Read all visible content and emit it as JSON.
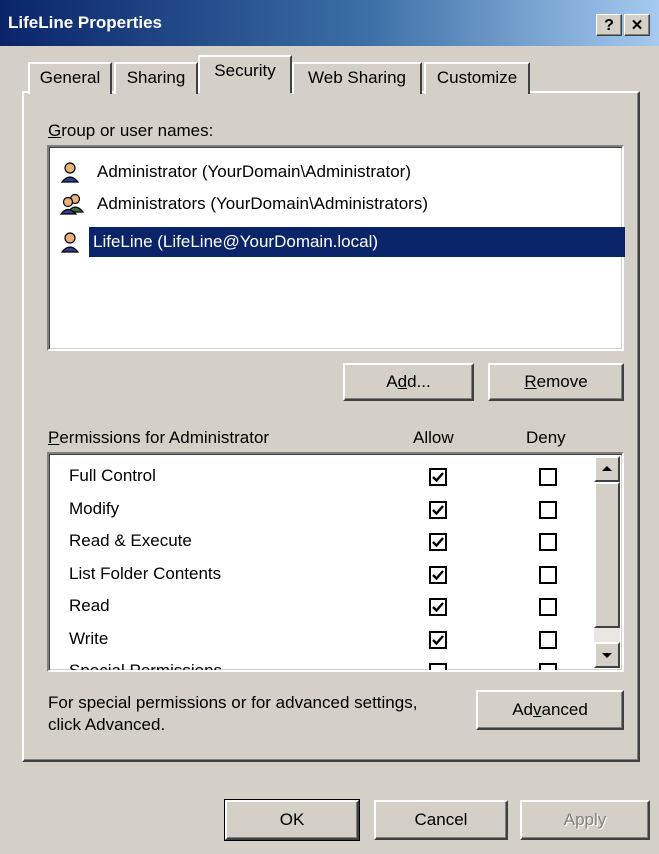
{
  "window": {
    "title": "LifeLine Properties",
    "help_button": "?",
    "close_button": "✕"
  },
  "tabs": [
    {
      "label": "General"
    },
    {
      "label": "Sharing"
    },
    {
      "label": "Security",
      "active": true
    },
    {
      "label": "Web Sharing"
    },
    {
      "label": "Customize"
    }
  ],
  "group_list": {
    "label_prefix": "G",
    "label_rest": "roup or user names:",
    "items": [
      {
        "name": "Administrator (YourDomain\\Administrator)",
        "icon": "user-icon",
        "selected": false
      },
      {
        "name": "Administrators (YourDomain\\Administrators)",
        "icon": "group-icon",
        "selected": false
      },
      {
        "name": "LifeLine (LifeLine@YourDomain.local)",
        "icon": "user-icon",
        "selected": true
      }
    ]
  },
  "buttons": {
    "add_pre": "A",
    "add_u": "d",
    "add_post": "d...",
    "remove_u": "R",
    "remove_post": "emove",
    "advanced_pre": "Ad",
    "advanced_u": "v",
    "advanced_post": "anced",
    "ok": "OK",
    "cancel": "Cancel",
    "apply": "Apply"
  },
  "permissions": {
    "label_u": "P",
    "label_rest": "ermissions for Administrator",
    "allow_header": "Allow",
    "deny_header": "Deny",
    "rows": [
      {
        "name": "Full Control",
        "allow": true,
        "deny": false
      },
      {
        "name": "Modify",
        "allow": true,
        "deny": false
      },
      {
        "name": "Read & Execute",
        "allow": true,
        "deny": false
      },
      {
        "name": "List Folder Contents",
        "allow": true,
        "deny": false
      },
      {
        "name": "Read",
        "allow": true,
        "deny": false
      },
      {
        "name": "Write",
        "allow": true,
        "deny": false
      },
      {
        "name": "Special Permissions",
        "allow": false,
        "deny": false
      }
    ]
  },
  "advanced_note": {
    "line1": "For special permissions or for advanced settings,",
    "line2": "click Advanced."
  },
  "colors": {
    "face": "#d4d0c8",
    "selection": "#0a246a",
    "title_start": "#0a246a",
    "title_end": "#a6caf0"
  }
}
